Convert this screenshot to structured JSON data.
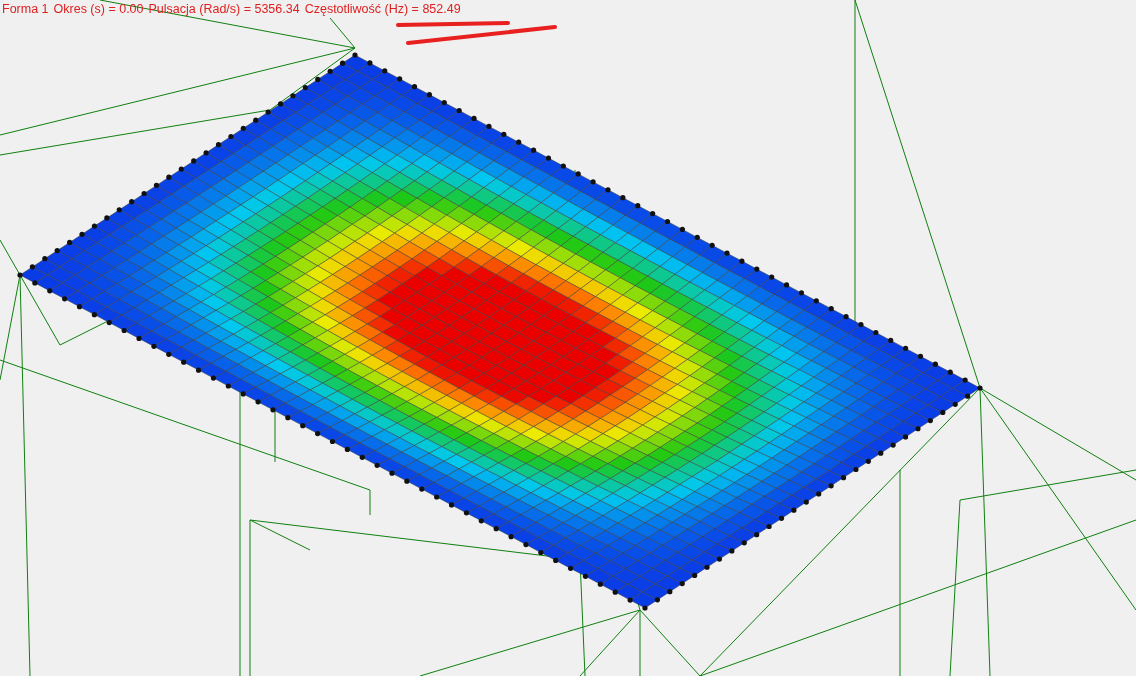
{
  "header": {
    "parts": [
      "Forma 1",
      "Okres (s) = 0.00",
      "Pulsacja (Rad/s) = 5356.34",
      "Częstotliwość (Hz) = 852.49"
    ]
  }
}
